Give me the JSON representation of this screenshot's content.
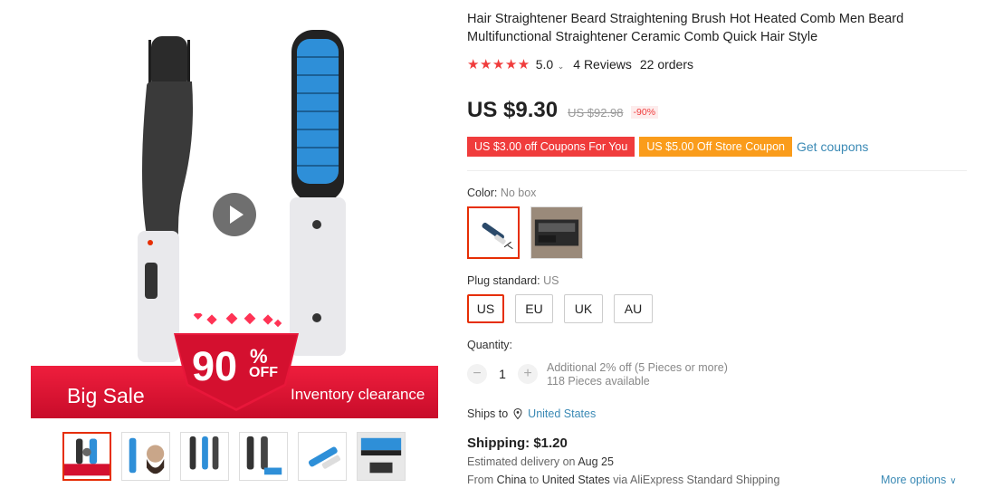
{
  "product": {
    "title": "Hair Straightener Beard Straightening Brush Hot Heated Comb Men Beard Multifunctional Straightener Ceramic Comb Quick Hair Style",
    "rating": {
      "stars": "★★★★★",
      "score": "5.0",
      "reviews": "4 Reviews",
      "orders": "22 orders"
    },
    "price": "US $9.30",
    "old_price": "US $92.98",
    "discount": "-90%",
    "coupons": {
      "coupon1": "US $3.00 off Coupons For You",
      "coupon2": "US $5.00 Off Store Coupon",
      "get_coupons": "Get coupons"
    }
  },
  "banner": {
    "percent": "90",
    "percent_sign": "%",
    "off": "OFF",
    "left_text": "Big Sale",
    "right_text": "Inventory clearance"
  },
  "options": {
    "color_label": "Color:",
    "color_value": "No box",
    "plug_label": "Plug standard:",
    "plug_value": "US",
    "plugs": [
      "US",
      "EU",
      "UK",
      "AU"
    ],
    "quantity_label": "Quantity:",
    "quantity_value": "1",
    "qty_minus": "−",
    "qty_plus": "+",
    "additional": "Additional 2% off (5 Pieces or more)",
    "available": "118 Pieces available"
  },
  "shipping": {
    "ships_to_label": "Ships to",
    "ships_to_country": "United States",
    "shipping_cost": "Shipping: $1.20",
    "estimated_prefix": "Estimated delivery on",
    "estimated_date": "Aug 25",
    "route_from": "From",
    "route_origin": "China",
    "route_to": "to",
    "route_dest": "United States",
    "route_via": "via AliExpress Standard Shipping",
    "more_options": "More options",
    "more_chevron": "∨"
  },
  "colors": {
    "accent_red": "#e62e04",
    "star_red": "#f03c3c",
    "coupon_orange": "#fa9c1b",
    "link_blue": "#3b8ab5",
    "brush_blue": "#2e8fd8"
  },
  "icons": {
    "play": "play-icon",
    "location": "location-pin-icon",
    "chevron": "chevron-down-icon"
  }
}
